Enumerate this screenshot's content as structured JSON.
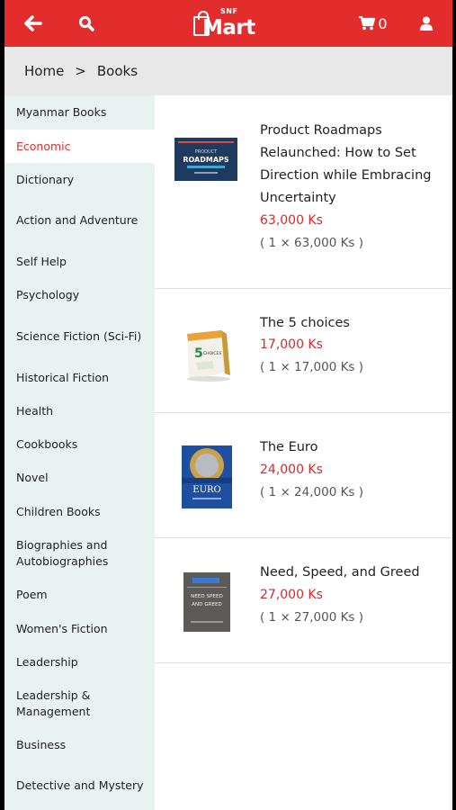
{
  "header": {
    "back_icon": "arrow-left-icon",
    "search_icon": "search-icon",
    "logo_small": "SNF",
    "logo_big": "Mart",
    "cart_icon": "cart-icon",
    "cart_count": "0",
    "user_icon": "user-icon",
    "accent": "#e32d2d"
  },
  "breadcrumb": {
    "home": "Home",
    "separator": ">",
    "current": "Books"
  },
  "sidebar": {
    "items": [
      {
        "label": "Myanmar Books"
      },
      {
        "label": "Economic",
        "active": true
      },
      {
        "label": "Dictionary"
      },
      {
        "label": "Action and Adventure"
      },
      {
        "label": "Self Help"
      },
      {
        "label": "Psychology"
      },
      {
        "label": "Science Fiction (Sci-Fi)"
      },
      {
        "label": "Historical Fiction"
      },
      {
        "label": "Health"
      },
      {
        "label": "Cookbooks"
      },
      {
        "label": "Novel"
      },
      {
        "label": "Children Books"
      },
      {
        "label": "Biographies and Autobiographies"
      },
      {
        "label": "Poem"
      },
      {
        "label": "Women's Fiction"
      },
      {
        "label": "Leadership"
      },
      {
        "label": "Leadership & Management"
      },
      {
        "label": "Business"
      },
      {
        "label": "Detective and Mystery"
      }
    ]
  },
  "products": [
    {
      "title": "Product Roadmaps Relaunched: How to Set Direction while Embracing Uncertainty",
      "price": "63,000 Ks",
      "qty": "( 1 × 63,000 Ks )",
      "cover_text": [
        "PRODUCT",
        "ROADMAPS"
      ]
    },
    {
      "title": "The 5 choices",
      "price": "17,000 Ks",
      "qty": "( 1 × 17,000 Ks )",
      "cover_text": [
        "5",
        "CHOICES"
      ]
    },
    {
      "title": "The Euro",
      "price": "24,000 Ks",
      "qty": "( 1 × 24,000 Ks )",
      "cover_text": [
        "EURO"
      ]
    },
    {
      "title": "Need, Speed, and Greed",
      "price": "27,000 Ks",
      "qty": "( 1 × 27,000 Ks )",
      "cover_text": [
        "NEED SPEED",
        "AND GREED"
      ]
    }
  ]
}
